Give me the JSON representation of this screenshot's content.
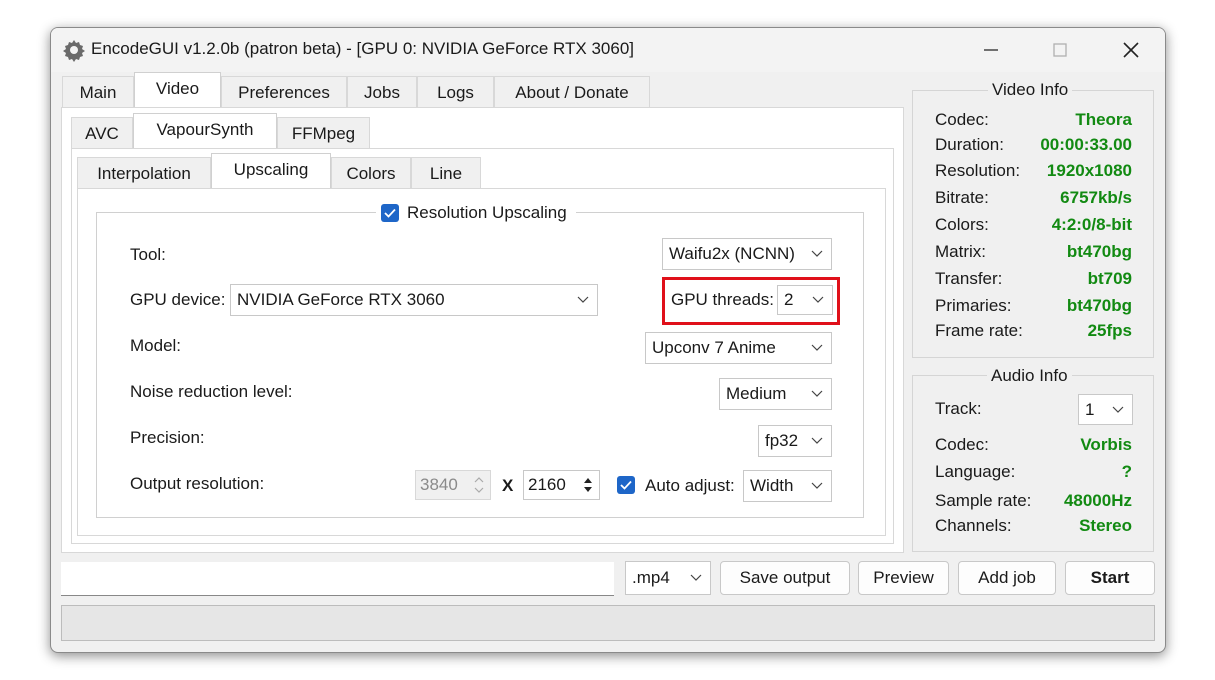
{
  "window": {
    "title": "EncodeGUI v1.2.0b (patron beta) - [GPU 0: NVIDIA GeForce RTX 3060]"
  },
  "main_tabs": [
    "Main",
    "Video",
    "Preferences",
    "Jobs",
    "Logs",
    "About / Donate"
  ],
  "sub_tabs": [
    "AVC",
    "VapourSynth",
    "FFMpeg"
  ],
  "inner_tabs": [
    "Interpolation",
    "Upscaling",
    "Colors",
    "Line"
  ],
  "upscaling": {
    "group_title": "Resolution Upscaling",
    "tool_label": "Tool:",
    "tool_value": "Waifu2x (NCNN)",
    "gpu_device_label": "GPU device:",
    "gpu_device_value": "NVIDIA GeForce RTX 3060",
    "gpu_threads_label": "GPU threads:",
    "gpu_threads_value": "2",
    "model_label": "Model:",
    "model_value": "Upconv 7 Anime",
    "noise_label": "Noise reduction level:",
    "noise_value": "Medium",
    "precision_label": "Precision:",
    "precision_value": "fp32",
    "output_label": "Output resolution:",
    "output_width": "3840",
    "x_label": "X",
    "output_height": "2160",
    "auto_adjust_label": "Auto adjust:",
    "auto_adjust_value": "Width"
  },
  "video_info": {
    "title": "Video Info",
    "rows": [
      {
        "key": "Codec:",
        "value": "Theora"
      },
      {
        "key": "Duration:",
        "value": "00:00:33.00"
      },
      {
        "key": "Resolution:",
        "value": "1920x1080"
      },
      {
        "key": "Bitrate:",
        "value": "6757kb/s"
      },
      {
        "key": "Colors:",
        "value": "4:2:0/8-bit"
      },
      {
        "key": "Matrix:",
        "value": "bt470bg"
      },
      {
        "key": "Transfer:",
        "value": "bt709"
      },
      {
        "key": "Primaries:",
        "value": "bt470bg"
      },
      {
        "key": "Frame rate:",
        "value": "25fps"
      }
    ]
  },
  "audio_info": {
    "title": "Audio Info",
    "track_label": "Track:",
    "track_value": "1",
    "rows": [
      {
        "key": "Codec:",
        "value": "Vorbis"
      },
      {
        "key": "Language:",
        "value": "?"
      },
      {
        "key": "Sample rate:",
        "value": "48000Hz"
      },
      {
        "key": "Channels:",
        "value": "Stereo"
      }
    ]
  },
  "bottom": {
    "output_path": "",
    "extension": ".mp4",
    "save_output": "Save output",
    "preview": "Preview",
    "add_job": "Add job",
    "start": "Start"
  },
  "colors": {
    "info_value_green": "#128a12",
    "highlight_red": "#e0101a",
    "checkbox_blue": "#1e66c8"
  }
}
